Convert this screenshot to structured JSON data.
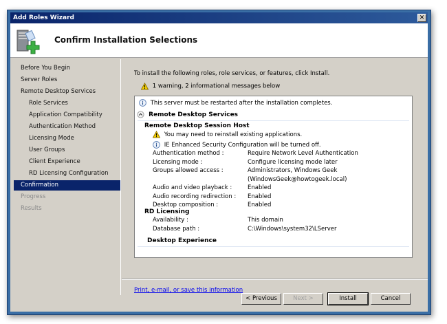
{
  "window": {
    "title": "Add Roles Wizard",
    "close": "✕"
  },
  "header": {
    "title": "Confirm Installation Selections"
  },
  "nav": [
    {
      "label": "Before You Begin",
      "state": "normal",
      "indent": 0
    },
    {
      "label": "Server Roles",
      "state": "normal",
      "indent": 0
    },
    {
      "label": "Remote Desktop Services",
      "state": "normal",
      "indent": 0
    },
    {
      "label": "Role Services",
      "state": "normal",
      "indent": 1
    },
    {
      "label": "Application Compatibility",
      "state": "normal",
      "indent": 1
    },
    {
      "label": "Authentication Method",
      "state": "normal",
      "indent": 1
    },
    {
      "label": "Licensing Mode",
      "state": "normal",
      "indent": 1
    },
    {
      "label": "User Groups",
      "state": "normal",
      "indent": 1
    },
    {
      "label": "Client Experience",
      "state": "normal",
      "indent": 1
    },
    {
      "label": "RD Licensing Configuration",
      "state": "normal",
      "indent": 1
    },
    {
      "label": "Confirmation",
      "state": "active",
      "indent": 0
    },
    {
      "label": "Progress",
      "state": "disabled",
      "indent": 0
    },
    {
      "label": "Results",
      "state": "disabled",
      "indent": 0
    }
  ],
  "main": {
    "intro": "To install the following roles, role services, or features, click Install.",
    "summary": "1 warning, 2 informational messages below",
    "restart_msg": "This server must be restarted after the installation completes.",
    "section": "Remote Desktop Services",
    "rdsh": {
      "title": "Remote Desktop Session Host",
      "warning": "You may need to reinstall existing applications.",
      "info": "IE Enhanced Security Configuration will be turned off.",
      "props": [
        {
          "label": "Authentication method :",
          "value": "Require Network Level Authentication"
        },
        {
          "label": "Licensing mode :",
          "value": "Configure licensing mode later"
        },
        {
          "label": "Groups allowed access :",
          "value": "Administrators, Windows Geek",
          "value2": "(WindowsGeek@howtogeek.local)"
        },
        {
          "label": "Audio and video playback :",
          "value": "Enabled"
        },
        {
          "label": "Audio recording redirection :",
          "value": "Enabled"
        },
        {
          "label": "Desktop composition :",
          "value": "Enabled"
        }
      ]
    },
    "rdl": {
      "title": "RD Licensing",
      "props": [
        {
          "label": "Availability :",
          "value": "This domain"
        },
        {
          "label": "Database path :",
          "value": "C:\\Windows\\system32\\LServer"
        }
      ]
    },
    "desktop_experience": "Desktop Experience",
    "link": "Print, e-mail, or save this information"
  },
  "buttons": {
    "previous": "< Previous",
    "next": "Next >",
    "install": "Install",
    "cancel": "Cancel"
  }
}
